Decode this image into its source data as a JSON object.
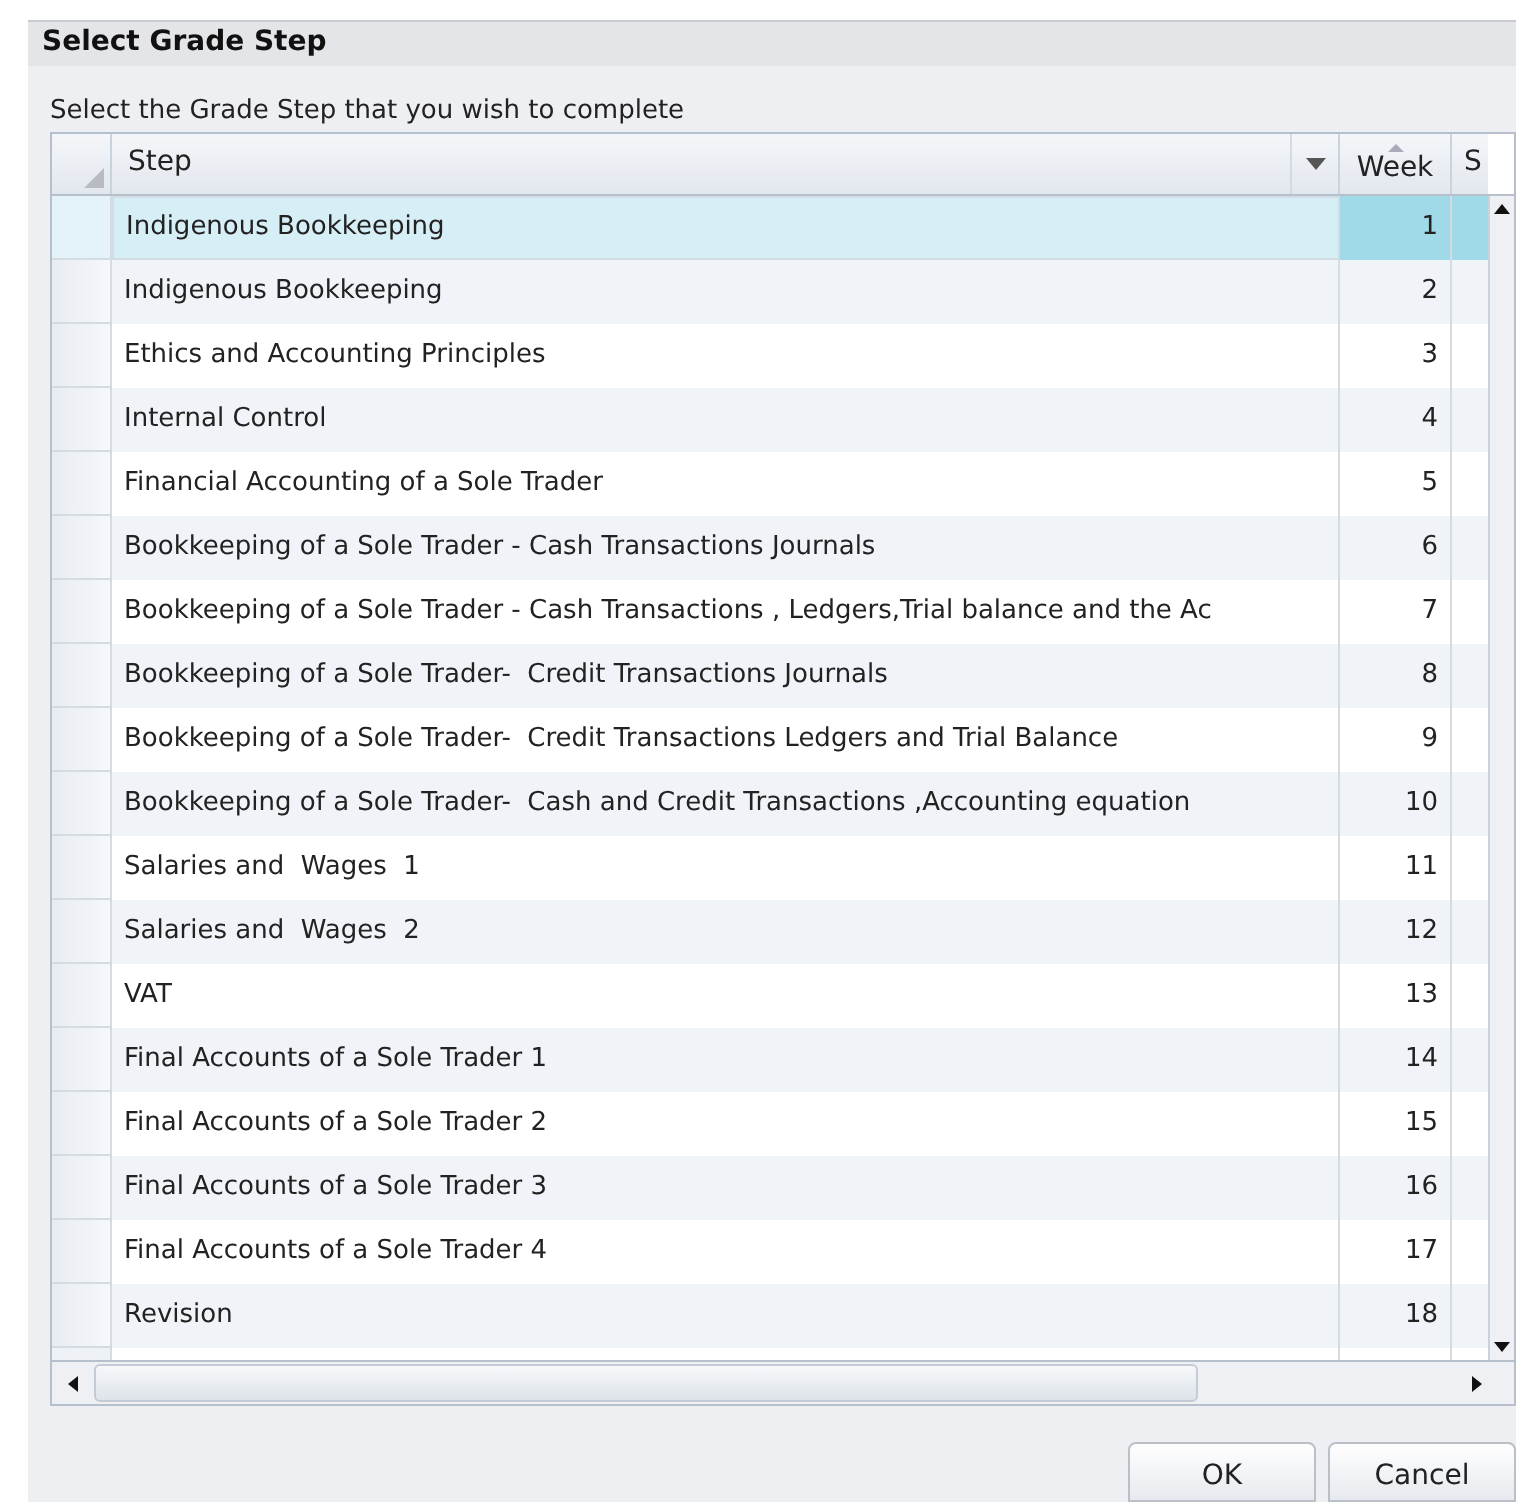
{
  "dialog": {
    "title": "Select Grade Step",
    "instruction": "Select the Grade Step that you wish to complete"
  },
  "table": {
    "columns": [
      {
        "label": "Step",
        "kind": "filter"
      },
      {
        "label": "Week",
        "kind": "sorted"
      },
      {
        "label": "S",
        "kind": "plain"
      }
    ],
    "rows": [
      {
        "step": "Indigenous Bookkeeping",
        "week": "1",
        "selected": true
      },
      {
        "step": "Indigenous Bookkeeping",
        "week": "2",
        "selected": false
      },
      {
        "step": "Ethics and Accounting Principles",
        "week": "3",
        "selected": false
      },
      {
        "step": "Internal Control",
        "week": "4",
        "selected": false
      },
      {
        "step": "Financial Accounting of a Sole Trader",
        "week": "5",
        "selected": false
      },
      {
        "step": "Bookkeeping of a Sole Trader - Cash Transactions Journals",
        "week": "6",
        "selected": false
      },
      {
        "step": "Bookkeeping of a Sole Trader - Cash Transactions , Ledgers,Trial balance and the Ac",
        "week": "7",
        "selected": false
      },
      {
        "step": "Bookkeeping of a Sole Trader-  Credit Transactions Journals",
        "week": "8",
        "selected": false
      },
      {
        "step": "Bookkeeping of a Sole Trader-  Credit Transactions Ledgers and Trial Balance",
        "week": "9",
        "selected": false
      },
      {
        "step": "Bookkeeping of a Sole Trader-  Cash and Credit Transactions ,Accounting equation",
        "week": "10",
        "selected": false
      },
      {
        "step": "Salaries and  Wages  1",
        "week": "11",
        "selected": false
      },
      {
        "step": "Salaries and  Wages  2",
        "week": "12",
        "selected": false
      },
      {
        "step": "VAT",
        "week": "13",
        "selected": false
      },
      {
        "step": "Final Accounts of a Sole Trader 1",
        "week": "14",
        "selected": false
      },
      {
        "step": "Final Accounts of a Sole Trader 2",
        "week": "15",
        "selected": false
      },
      {
        "step": "Final Accounts of a Sole Trader 3",
        "week": "16",
        "selected": false
      },
      {
        "step": "Final Accounts of a Sole Trader 4",
        "week": "17",
        "selected": false
      },
      {
        "step": "Revision",
        "week": "18",
        "selected": false
      }
    ]
  },
  "buttons": [
    "OK",
    "Cancel"
  ]
}
